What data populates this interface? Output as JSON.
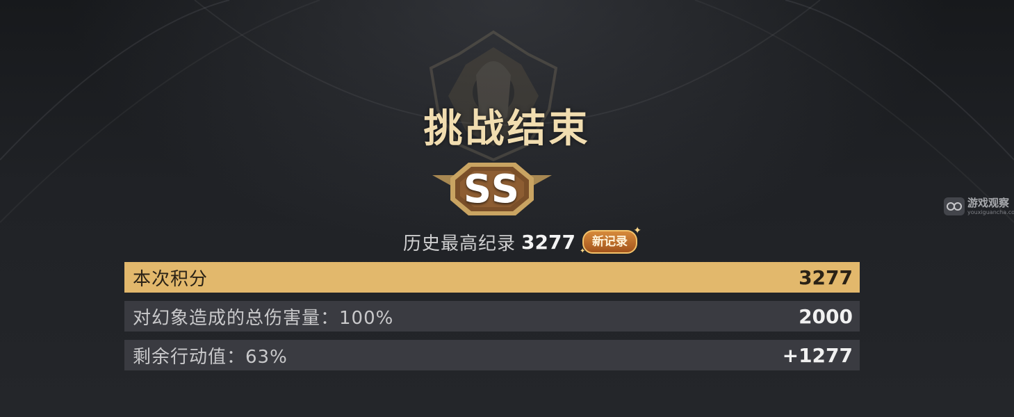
{
  "screen": {
    "title": "挑战结束",
    "rank": "SS"
  },
  "record": {
    "label": "历史最高纪录",
    "value": "3277",
    "new_badge": "新记录"
  },
  "score_rows": [
    {
      "label": "本次积分",
      "value": "3277",
      "highlight": true
    },
    {
      "label": "对幻象造成的总伤害量：100%",
      "value": "2000",
      "highlight": false
    },
    {
      "label": "剩余行动值：63%",
      "value": "+1277",
      "highlight": false
    }
  ],
  "watermark": {
    "title": "游戏观察",
    "subtitle": "youxiguancha.com",
    "icon": "controller-icon"
  },
  "colors": {
    "accent_gold": "#e2b86c",
    "title_gold": "#f1ddb0",
    "badge_bronze": "#8a5a2b",
    "row_bg": "#3e4045"
  }
}
